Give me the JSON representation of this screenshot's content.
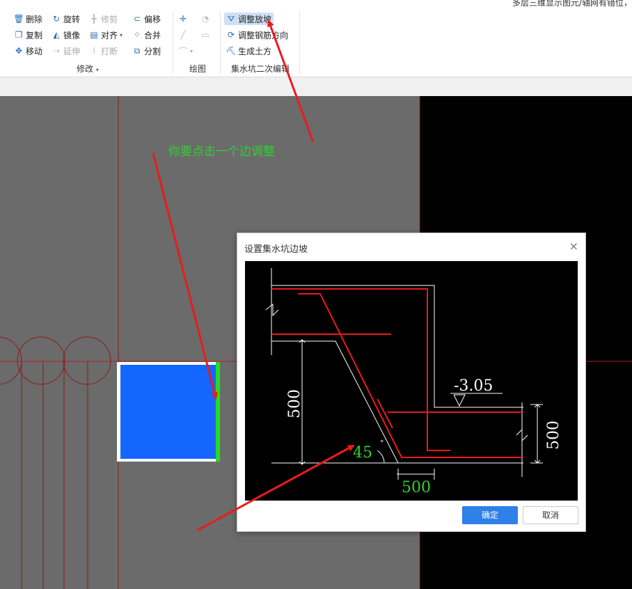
{
  "top_text": "多层三维显示图元/轴网有错位，",
  "ribbon": {
    "modify": {
      "tools": [
        {
          "label": "删除",
          "icon": "trash-icon",
          "enabled": true
        },
        {
          "label": "旋转",
          "icon": "rotate-icon",
          "enabled": true
        },
        {
          "label": "修剪",
          "icon": "trim-icon",
          "enabled": false
        },
        {
          "label": "偏移",
          "icon": "offset-icon",
          "enabled": true
        },
        {
          "label": "复制",
          "icon": "copy-icon",
          "enabled": true
        },
        {
          "label": "镜像",
          "icon": "mirror-icon",
          "enabled": true
        },
        {
          "label": "对齐",
          "icon": "align-icon",
          "enabled": true
        },
        {
          "label": "合并",
          "icon": "merge-icon",
          "enabled": true
        },
        {
          "label": "移动",
          "icon": "move-icon",
          "enabled": true
        },
        {
          "label": "延伸",
          "icon": "extend-icon",
          "enabled": false
        },
        {
          "label": "打断",
          "icon": "break-icon",
          "enabled": false
        },
        {
          "label": "分割",
          "icon": "split-icon",
          "enabled": true
        }
      ],
      "group_label": "修改"
    },
    "draw": {
      "group_label": "绘图"
    },
    "pit_edit": {
      "tools": [
        {
          "label": "调整放坡",
          "icon": "slope-icon",
          "active": true
        },
        {
          "label": "调整钢筋方向",
          "icon": "rebar-direction-icon",
          "active": false
        },
        {
          "label": "生成土方",
          "icon": "earthwork-icon",
          "active": false
        }
      ],
      "group_label": "集水坑二次编辑"
    }
  },
  "annotation": {
    "text": "你要点击一个边调整",
    "color": "#2fd12f"
  },
  "dialog": {
    "title": "设置集水坑边坡",
    "close": "×",
    "figure": {
      "elevation": "-3.05",
      "depth": "500",
      "right_dim": "500",
      "bottom_dim": "500",
      "angle": "45",
      "angle_unit": "°"
    },
    "ok": "确定",
    "cancel": "取消"
  },
  "colors": {
    "pit_fill": "#1565ff",
    "selected_edge": "#22dd22",
    "arrow": "#e81c1c",
    "axis": "#8b1a1a",
    "accent": "#2f80e7"
  }
}
